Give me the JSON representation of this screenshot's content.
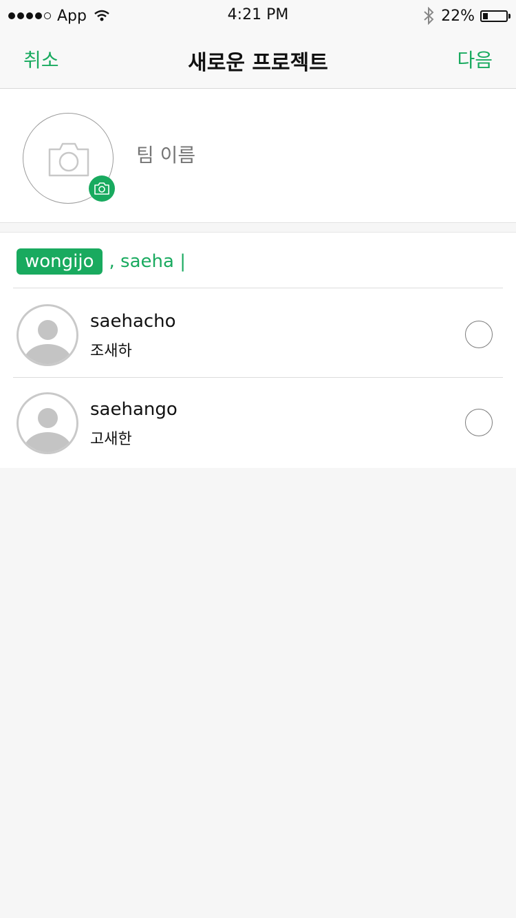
{
  "status_bar": {
    "carrier": "App",
    "time": "4:21 PM",
    "battery_percent": "22%",
    "battery_level": 0.22,
    "icons": [
      "signal-dots-icon",
      "wifi-icon",
      "bluetooth-icon",
      "battery-icon"
    ]
  },
  "nav": {
    "cancel_label": "취소",
    "title": "새로운 프로젝트",
    "next_label": "다음"
  },
  "team": {
    "name_placeholder": "팀 이름",
    "photo_icon": "camera-icon"
  },
  "invite": {
    "selected_tags": [
      "wongijo"
    ],
    "query_text": ", saeha |"
  },
  "users": [
    {
      "username": "saehacho",
      "display_name": "조새하",
      "selected": false
    },
    {
      "username": "saehango",
      "display_name": "고새한",
      "selected": false
    }
  ],
  "colors": {
    "accent": "#19aa5f",
    "background": "#f6f6f6"
  }
}
